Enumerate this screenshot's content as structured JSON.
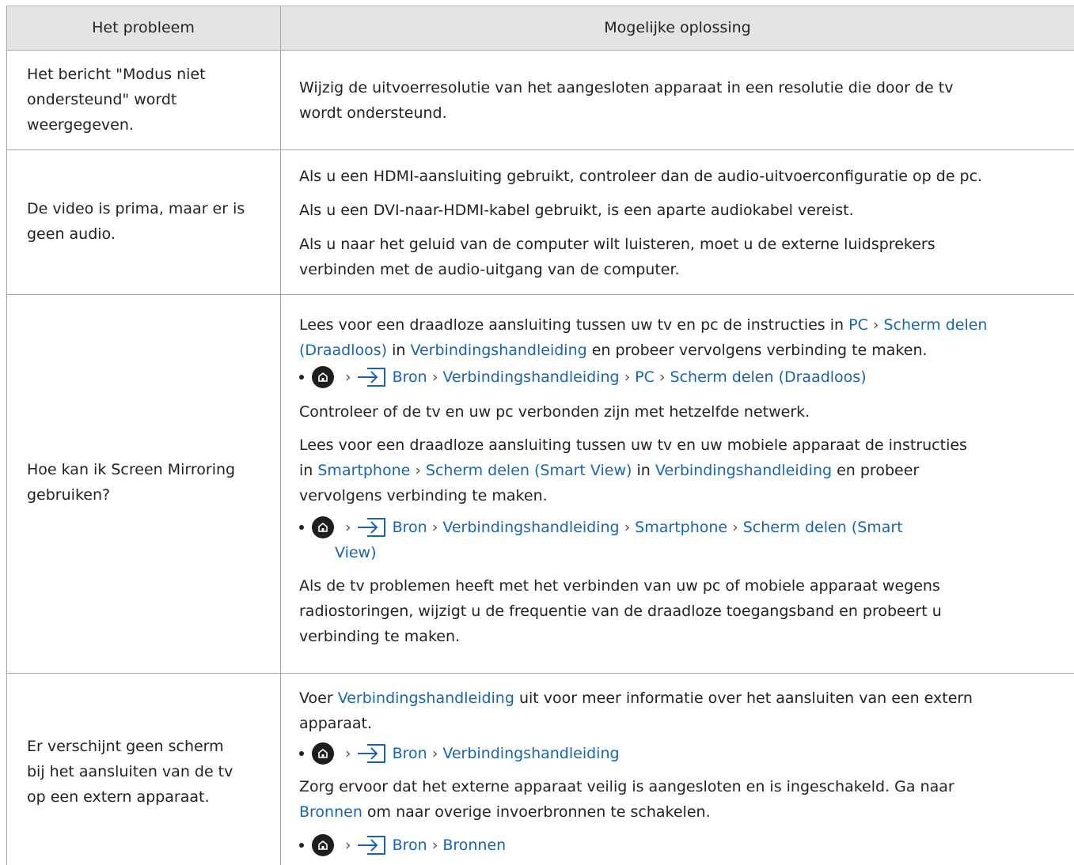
{
  "header": {
    "problem": "Het probleem",
    "solution": "Mogelijke oplossing"
  },
  "rows": [
    {
      "problem_lines": [
        "Het bericht \"Modus niet",
        "ondersteund\" wordt",
        "weergegeven."
      ],
      "solution_lines": [
        "Wijzig de uitvoerresolutie van het aangesloten apparaat in een resolutie die door de tv",
        "wordt ondersteund."
      ]
    },
    {
      "problem_lines": [
        "De video is prima, maar er is",
        "geen audio."
      ],
      "solution_lines": [
        "Als u een HDMI-aansluiting gebruikt, controleer dan de audio-uitvoerconfiguratie op de pc.",
        "Als u een DVI-naar-HDMI-kabel gebruikt, is een aparte audiokabel vereist.",
        "Als u naar het geluid van de computer wilt luisteren, moet u de externe luidsprekers",
        "verbinden met de audio-uitgang van de computer."
      ]
    },
    {
      "problem_lines": [
        "Hoe kan ik Screen Mirroring",
        "gebruiken?"
      ],
      "p1_pre": "Lees voor een draadloze aansluiting tussen uw tv en pc de instructies in ",
      "p1_link1": "PC",
      "p1_link2a": "Scherm delen",
      "p1_link2b": "(Draadloos)",
      "p1_mid": " in ",
      "p1_link3": "Verbindingshandleiding",
      "p1_post": " en probeer vervolgens verbinding te maken.",
      "nav1": [
        "Bron",
        "Verbindingshandleiding",
        "PC",
        "Scherm delen (Draadloos)"
      ],
      "p2": "Controleer of de tv en uw pc verbonden zijn met hetzelfde netwerk.",
      "p3_l1": "Lees voor een draadloze aansluiting tussen uw tv en uw mobiele apparaat de instructies",
      "p3_pre": "in ",
      "p3_link1": "Smartphone",
      "p3_link2": "Scherm delen (Smart View)",
      "p3_mid": " in ",
      "p3_link3": "Verbindingshandleiding",
      "p3_post": " en probeer",
      "p3_l3": "vervolgens verbinding te maken.",
      "nav2": [
        "Bron",
        "Verbindingshandleiding",
        "Smartphone",
        "Scherm delen (Smart"
      ],
      "nav2_cont": "View)",
      "p4_lines": [
        "Als de tv problemen heeft met het verbinden van uw pc of mobiele apparaat wegens",
        "radiostoringen, wijzigt u de frequentie van de draadloze toegangsband en probeert u",
        "verbinding te maken."
      ]
    },
    {
      "problem_lines": [
        "Er verschijnt geen scherm",
        "bij het aansluiten van de tv",
        "op een extern apparaat."
      ],
      "p1_pre": "Voer ",
      "p1_link": "Verbindingshandleiding",
      "p1_post": " uit voor meer informatie over het aansluiten van een extern",
      "p1_l2": "apparaat.",
      "nav1": [
        "Bron",
        "Verbindingshandleiding"
      ],
      "p2_l1": "Zorg ervoor dat het externe apparaat veilig is aangesloten en is ingeschakeld. Ga naar",
      "p2_link": "Bronnen",
      "p2_post": " om naar overige invoerbronnen te schakelen.",
      "nav2": [
        "Bron",
        "Bronnen"
      ]
    }
  ],
  "icons": {
    "home": "home-icon",
    "source": "source-icon",
    "separator": "chevron-right-icon"
  },
  "colors": {
    "link": "#1765b0",
    "header_bg": "#e4e4e4",
    "border": "#a6a6a6"
  }
}
